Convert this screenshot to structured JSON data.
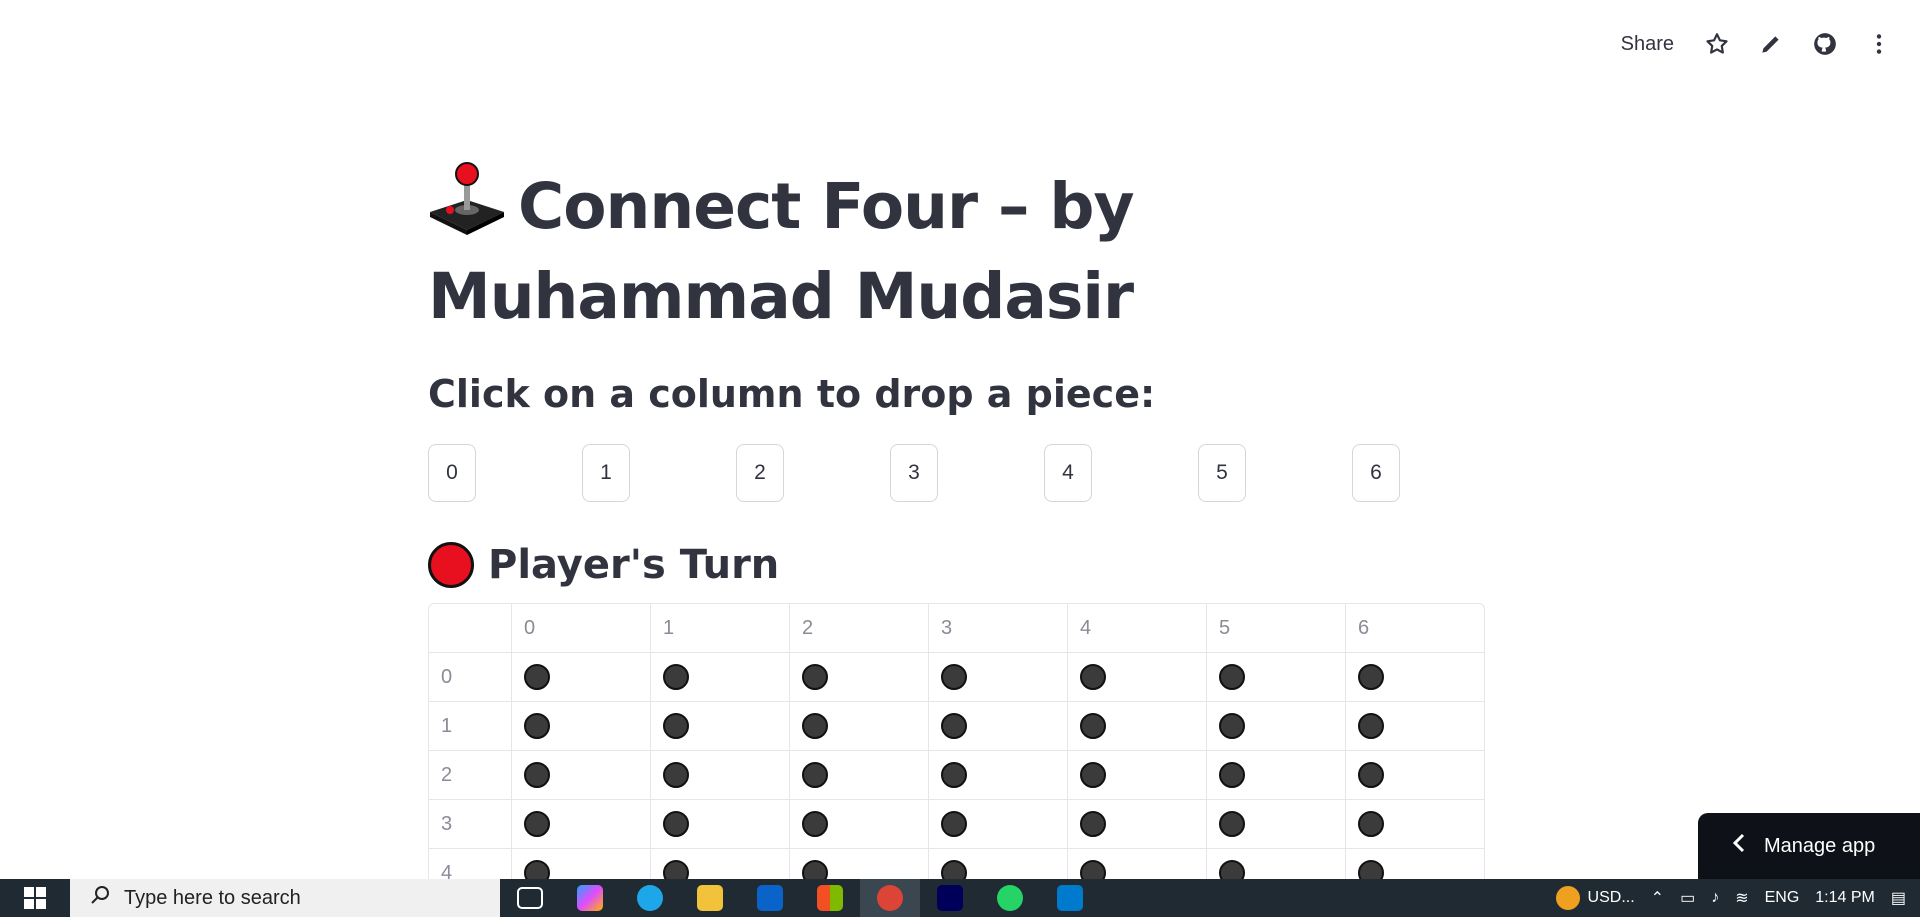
{
  "toolbar": {
    "share_label": "Share"
  },
  "page": {
    "title": "Connect Four – by Muhammad Mudasir",
    "subtitle": "Click on a column to drop a piece:",
    "column_buttons": [
      "0",
      "1",
      "2",
      "3",
      "4",
      "5",
      "6"
    ],
    "turn_text": "Player's Turn",
    "turn_color": "#e8101e"
  },
  "board": {
    "columns": [
      "0",
      "1",
      "2",
      "3",
      "4",
      "5",
      "6"
    ],
    "rows": [
      "0",
      "1",
      "2",
      "3",
      "4"
    ]
  },
  "manage_app": {
    "label": "Manage app"
  },
  "taskbar": {
    "search_placeholder": "Type here to search",
    "usd_label": "USD...",
    "lang": "ENG",
    "time": "1:14 PM"
  },
  "colors": {
    "accent": "#e8101e",
    "disc": "#3b3b3b",
    "dark": "#0e1117"
  }
}
